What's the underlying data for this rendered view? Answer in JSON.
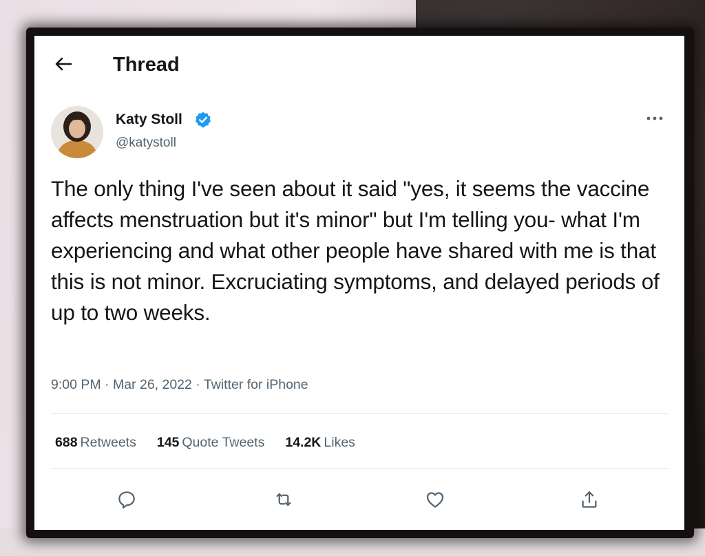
{
  "header": {
    "title": "Thread",
    "back_icon": "arrow-left-icon"
  },
  "author": {
    "name": "Katy Stoll",
    "handle": "@katystoll",
    "verified_icon": "verified-badge-icon"
  },
  "tweet": {
    "text": "The only thing I've seen about it said \"yes, it seems the vaccine affects menstruation but it's minor\" but I'm telling you- what I'm experiencing and what other people have shared with me is that this is not minor. Excruciating symptoms, and delayed periods of up to two weeks.",
    "time": "9:00 PM",
    "date": "Mar 26, 2022",
    "source": "Twitter for iPhone",
    "sep": "·"
  },
  "stats": {
    "retweets_count": "688",
    "retweets_label": "Retweets",
    "quotes_count": "145",
    "quotes_label": "Quote Tweets",
    "likes_count": "14.2K",
    "likes_label": "Likes"
  },
  "actions": [
    "reply-icon",
    "retweet-icon",
    "like-icon",
    "share-icon"
  ],
  "colors": {
    "verified": "#1d9bf0",
    "text": "#14171a",
    "secondary": "#536471"
  }
}
